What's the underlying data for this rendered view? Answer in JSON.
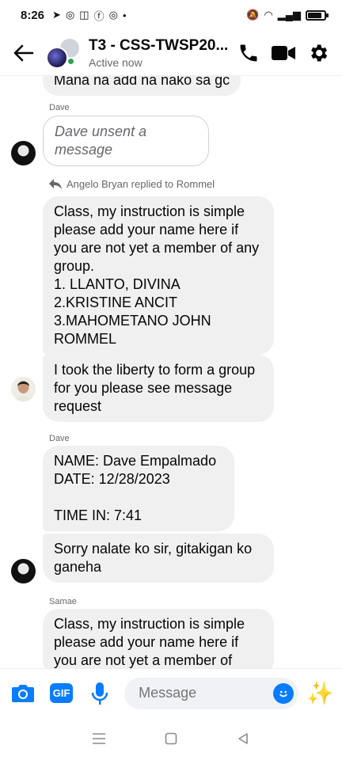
{
  "status_bar": {
    "time": "8:26",
    "left_icons": [
      "telegram-icon",
      "messenger-icon",
      "instagram-icon",
      "facebook-icon",
      "messenger-icon"
    ],
    "right_icons": [
      "mute-icon",
      "wifi-icon",
      "signal-icon",
      "battery-icon"
    ]
  },
  "header": {
    "title": "T3 - CSS-TWSP20...",
    "status": "Active now",
    "accent": "#0a7cff"
  },
  "messages": {
    "m0_text": "Mana na add na nako sa gc",
    "m1_sender": "Dave",
    "m1_text": "Dave unsent a\nmessage",
    "m2_reply": "Angelo Bryan replied to Rommel",
    "m2_text": "Class, my instruction is simple please add your name here if you are not yet a member of any group.\n1. LLANTO, DIVINA\n2.KRISTINE ANCIT\n3.MAHOMETANO JOHN ROMMEL",
    "m3_text": "I took the liberty to form a group for you please see message request",
    "m4_sender": "Dave",
    "m4_text": "NAME: Dave Empalmado\nDATE: 12/28/2023\n\nTIME IN: 7:41",
    "m5_text": "Sorry nalate ko sir, gitakigan ko ganeha",
    "m6_sender": "Samae",
    "m6_text": "Class, my instruction is simple please add your name here if you are not yet a member of"
  },
  "composer": {
    "placeholder": "Message",
    "gif_label": "GIF"
  },
  "colors": {
    "bubble": "#f0f0f0",
    "messenger_blue": "#0a7cff",
    "online": "#31a24c"
  }
}
